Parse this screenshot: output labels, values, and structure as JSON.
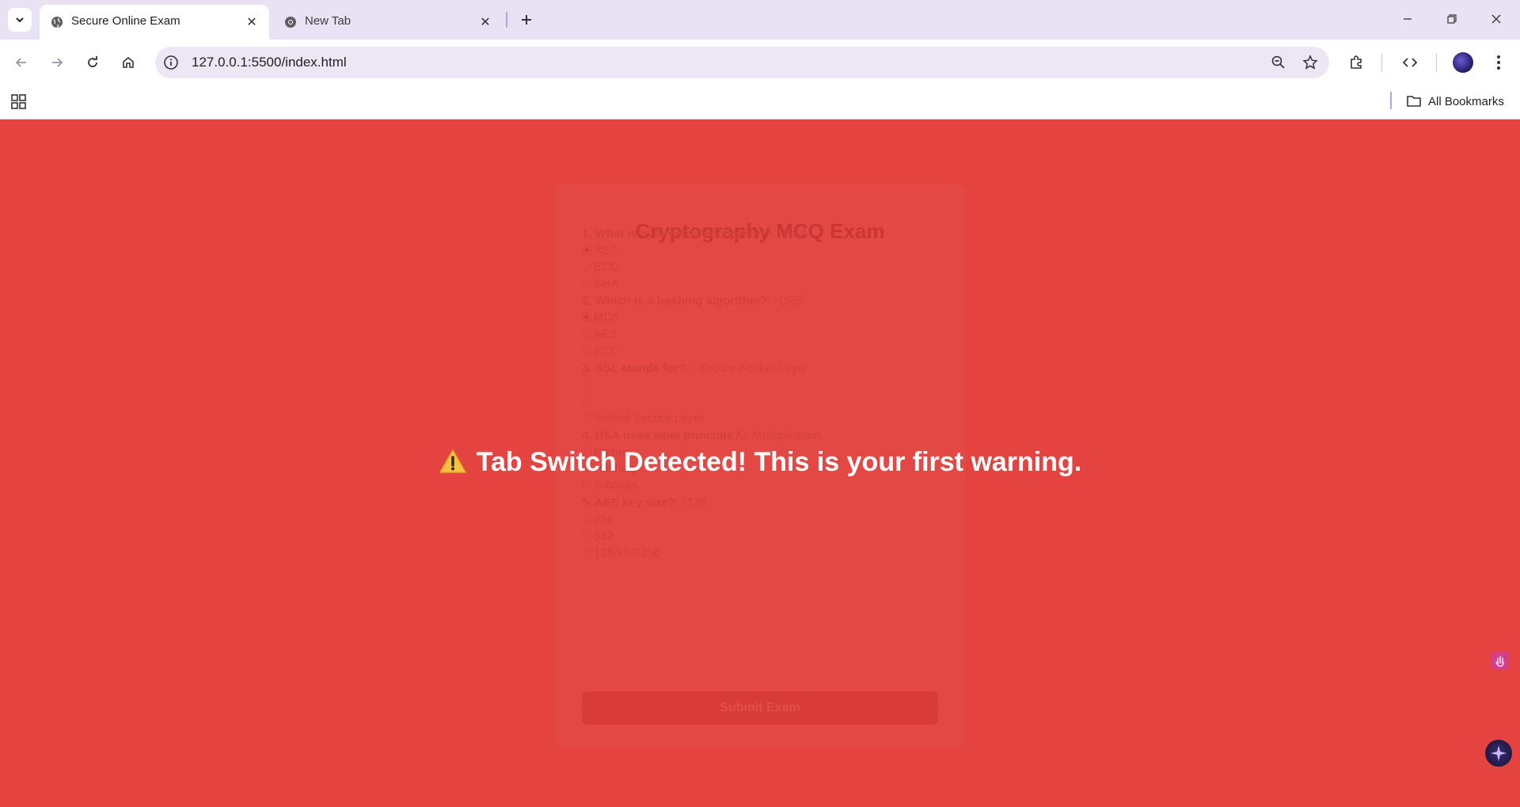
{
  "browser": {
    "tabs": [
      {
        "title": "Secure Online Exam",
        "active": true
      },
      {
        "title": "New Tab",
        "active": false
      }
    ],
    "url": "127.0.0.1:5500/index.html",
    "bookmarks_label": "All Bookmarks"
  },
  "exam": {
    "title": "Cryptography MCQ Exam",
    "questions": [
      {
        "text": "1. What is symmetric encryption?",
        "options": [
          "RSA",
          "AES",
          "ECC",
          "SHA"
        ],
        "selected": 1
      },
      {
        "text": "2. Which is a hashing algorithm?",
        "options": [
          "DES",
          "MD5",
          "AES",
          "ECC"
        ],
        "selected": 1
      },
      {
        "text": "3. SSL stands for?",
        "options": [
          "Secure Socket Layer",
          "",
          "",
          "Socket Secure Layer"
        ],
        "selected": -1
      },
      {
        "text": "4. RSA uses what principle?",
        "options": [
          "Multiplication",
          "Primes",
          "Hashing",
          "S-boxes"
        ],
        "selected": -1
      },
      {
        "text": "5. AES key size?",
        "options": [
          "128",
          "256",
          "512",
          "128/192/256"
        ],
        "selected": -1
      }
    ],
    "submit_label": "Submit Exam"
  },
  "warning": {
    "message": "Tab Switch Detected! This is your first warning.",
    "icon": "warning-triangle-icon"
  },
  "colors": {
    "overlay": "#e4433f",
    "tabstrip": "#e9e1f4",
    "omnibox": "#ede6f5"
  }
}
